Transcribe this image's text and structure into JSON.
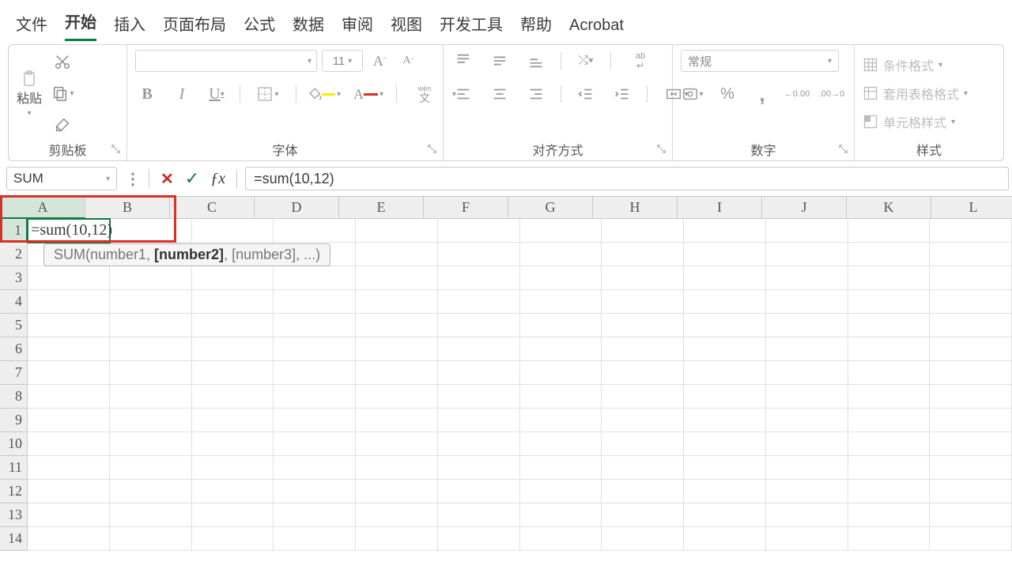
{
  "menu": {
    "tabs": [
      "文件",
      "开始",
      "插入",
      "页面布局",
      "公式",
      "数据",
      "审阅",
      "视图",
      "开发工具",
      "帮助",
      "Acrobat"
    ],
    "active_index": 1
  },
  "ribbon": {
    "clipboard": {
      "paste_label": "粘贴",
      "group_label": "剪贴板"
    },
    "font": {
      "size": "11",
      "bold": "B",
      "italic": "I",
      "underline": "U",
      "phonetic": "wén",
      "phonetic2": "文",
      "group_label": "字体"
    },
    "alignment": {
      "wrap": "ab",
      "group_label": "对齐方式"
    },
    "number": {
      "format": "常规",
      "group_label": "数字"
    },
    "styles": {
      "cond": "条件格式",
      "table": "套用表格格式",
      "cell": "单元格样式",
      "group_label": "样式"
    }
  },
  "formula_bar": {
    "name_box": "SUM",
    "formula": "=sum(10,12)"
  },
  "grid": {
    "columns": [
      "A",
      "B",
      "C",
      "D",
      "E",
      "F",
      "G",
      "H",
      "I",
      "J",
      "K",
      "L"
    ],
    "rows": [
      1,
      2,
      3,
      4,
      5,
      6,
      7,
      8,
      9,
      10,
      11,
      12,
      13,
      14
    ],
    "active_row": 1,
    "active_col": 0,
    "a1_text": "=sum(10,12)",
    "tooltip_prefix": "SUM(number1, ",
    "tooltip_bold": "[number2]",
    "tooltip_suffix": ", [number3], ...)"
  }
}
